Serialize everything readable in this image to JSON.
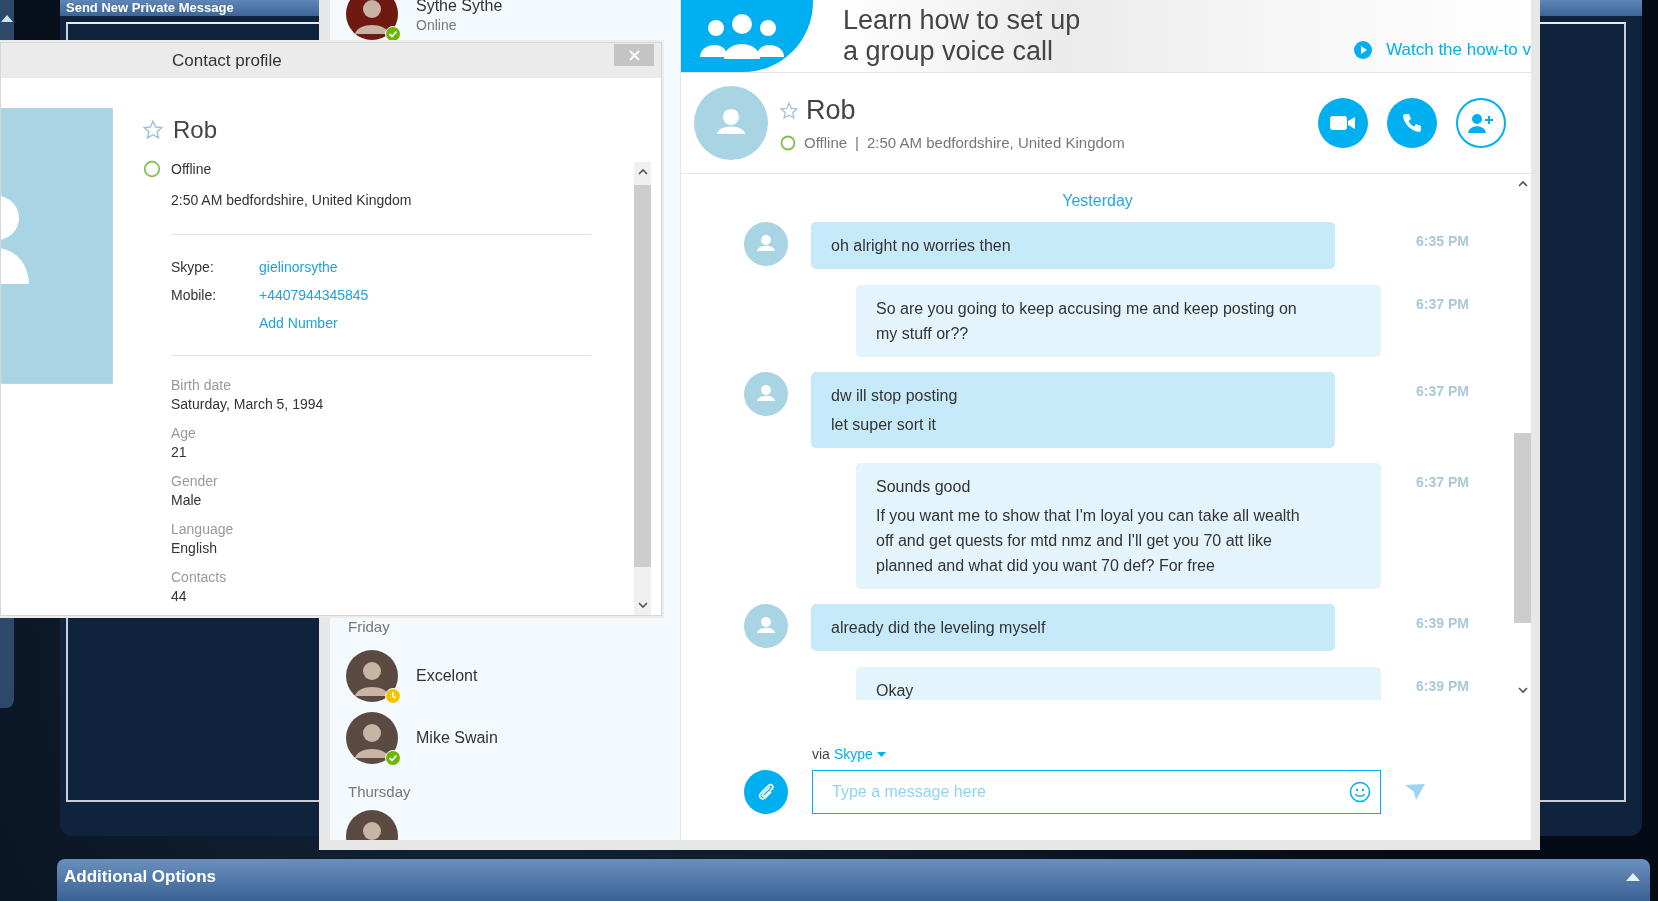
{
  "forum": {
    "header": "Send New Private Message",
    "footer_bar": "Additional Options"
  },
  "contact_list": {
    "items": [
      {
        "kind": "contact",
        "name": "Sythe Sythe",
        "subtitle": "Online",
        "color": "#6bb700"
      },
      {
        "kind": "heading",
        "label": "Friday"
      },
      {
        "kind": "contact",
        "name": "Excelont",
        "color": "#f8c300"
      },
      {
        "kind": "contact",
        "name": "Mike Swain",
        "color": "#6bb700"
      },
      {
        "kind": "heading",
        "label": "Thursday"
      },
      {
        "kind": "contact"
      }
    ]
  },
  "banner": {
    "lines": [
      "Learn how to set up",
      "a group voice call"
    ],
    "link": "Watch the how-to v"
  },
  "chat": {
    "name": "Rob",
    "favorite": false,
    "online": false,
    "status": "Offline",
    "separator": "|",
    "location": "2:50 AM bedfordshire, United Kingdom",
    "day": "Yesterday",
    "messages": [
      {
        "outgoing": false,
        "lines": [
          "oh alright no worries then"
        ],
        "time": "6:35 PM"
      },
      {
        "outgoing": true,
        "lines": [
          "So are you going to keep accusing me and keep posting on my stuff or??"
        ],
        "time": "6:37 PM"
      },
      {
        "outgoing": false,
        "lines": [
          "dw ill stop posting",
          "let super sort it"
        ],
        "time": "6:37 PM"
      },
      {
        "outgoing": true,
        "lines": [
          "Sounds good",
          "If you want me to show that I'm loyal you can take all wealth off and get quests for mtd nmz and I'll get you 70 att like planned and what did you want 70 def? For free"
        ],
        "time": "6:37 PM"
      },
      {
        "outgoing": false,
        "lines": [
          "already did the leveling myself"
        ],
        "time": "6:39 PM"
      },
      {
        "outgoing": true,
        "lines": [
          "Okay"
        ],
        "time": "6:39 PM"
      }
    ],
    "composer": {
      "via": "via",
      "service": "Skype",
      "placeholder": "Type a message here"
    }
  },
  "profile": {
    "title": "Contact profile",
    "name": "Rob",
    "favorite": false,
    "online": false,
    "status": "Offline",
    "location": "2:50 AM bedfordshire, United Kingdom",
    "fields": [
      {
        "label": "Skype:",
        "values": [
          "gielinorsythe"
        ]
      },
      {
        "label": "Mobile:",
        "values": [
          "+4407944345845",
          "Add Number"
        ]
      }
    ],
    "details": [
      {
        "label": "Birth date",
        "value": "Saturday, March 5, 1994"
      },
      {
        "label": "Age",
        "value": "21"
      },
      {
        "label": "Gender",
        "value": "Male"
      },
      {
        "label": "Language",
        "value": "English"
      },
      {
        "label": "Contacts",
        "value": "44"
      }
    ]
  }
}
